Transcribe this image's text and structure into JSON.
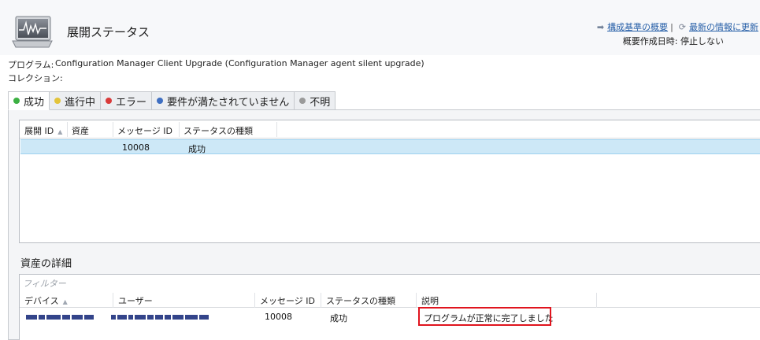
{
  "header": {
    "title": "展開ステータス",
    "monitor_icon": "monitor-chart-icon",
    "link_baseline": "構成基準の概要",
    "link_refresh": "最新の情報に更新",
    "separator": "|",
    "summary_time": "概要作成日時: 停止しない"
  },
  "meta": {
    "program_label": "プログラム:",
    "program_value": "Configuration Manager Client Upgrade (Configuration Manager agent silent upgrade)",
    "collection_label": "コレクション:"
  },
  "tabs": [
    {
      "label": "成功",
      "color": "#3cb043",
      "active": true
    },
    {
      "label": "進行中",
      "color": "#e3c43a",
      "active": false
    },
    {
      "label": "エラー",
      "color": "#d93a3a",
      "active": false
    },
    {
      "label": "要件が満たされていません",
      "color": "#3f6fc2",
      "active": false
    },
    {
      "label": "不明",
      "color": "#9a9a9a",
      "active": false
    }
  ],
  "deploy_grid": {
    "columns": [
      "展開 ID",
      "資産",
      "メッセージ ID",
      "ステータスの種類"
    ],
    "rows": [
      {
        "deploy_id": "",
        "asset": "",
        "message_id": "10008",
        "status_type": "成功"
      }
    ]
  },
  "asset_details": {
    "title": "資産の詳細",
    "filter_placeholder": "フィルター",
    "columns": [
      "デバイス",
      "ユーザー",
      "メッセージ ID",
      "ステータスの種類",
      "説明"
    ],
    "rows": [
      {
        "device": "",
        "user": "",
        "message_id": "10008",
        "status_type": "成功",
        "description": "プログラムが正常に完了しました"
      }
    ]
  }
}
